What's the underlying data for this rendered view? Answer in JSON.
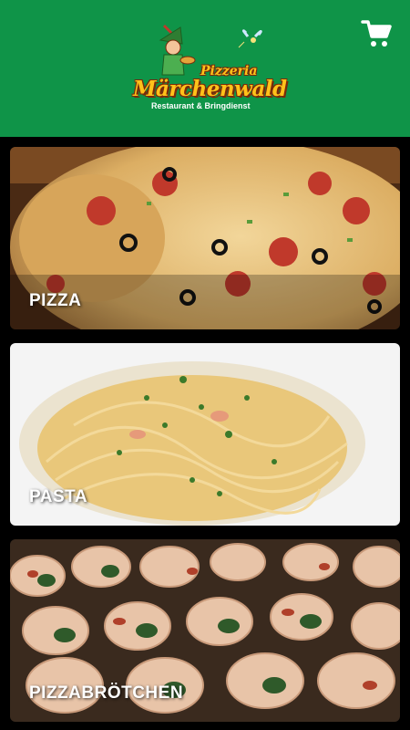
{
  "header": {
    "logo": {
      "title_small": "Pizzeria",
      "title_main": "Märchenwald",
      "subtitle": "Restaurant & Bringdienst"
    },
    "cart_icon": "shopping-cart-icon",
    "background_color": "#0f9448"
  },
  "categories": [
    {
      "label": "PIZZA"
    },
    {
      "label": "PASTA"
    },
    {
      "label": "PIZZABRÖTCHEN"
    }
  ]
}
